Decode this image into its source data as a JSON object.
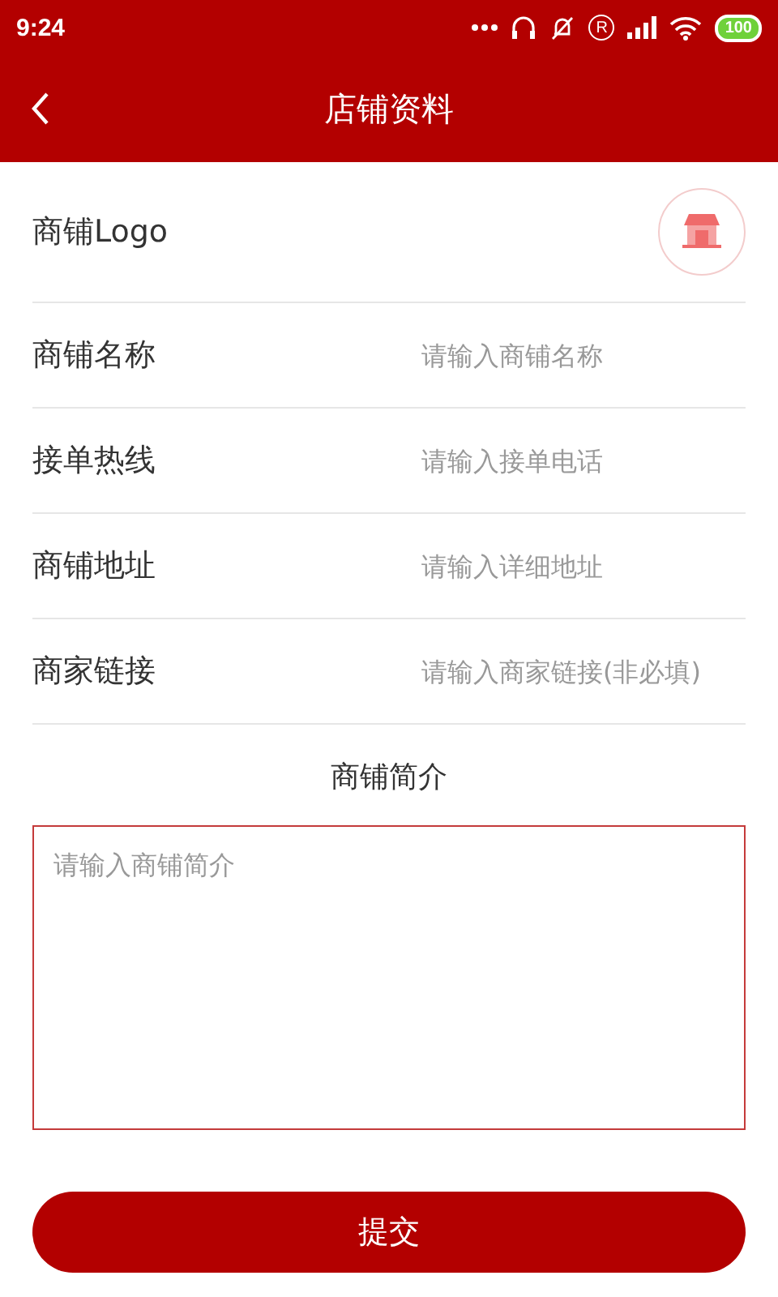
{
  "status_bar": {
    "time": "9:24",
    "registered_mark": "R",
    "battery": "100"
  },
  "header": {
    "title": "店铺资料"
  },
  "logo_row": {
    "label": "商铺Logo"
  },
  "fields": [
    {
      "label": "商铺名称",
      "placeholder": "请输入商铺名称"
    },
    {
      "label": "接单热线",
      "placeholder": "请输入接单电话"
    },
    {
      "label": "商铺地址",
      "placeholder": "请输入详细地址"
    },
    {
      "label": "商家链接",
      "placeholder": "请输入商家链接(非必填)"
    }
  ],
  "intro": {
    "title": "商铺简介",
    "placeholder": "请输入商铺简介"
  },
  "submit": "提交"
}
